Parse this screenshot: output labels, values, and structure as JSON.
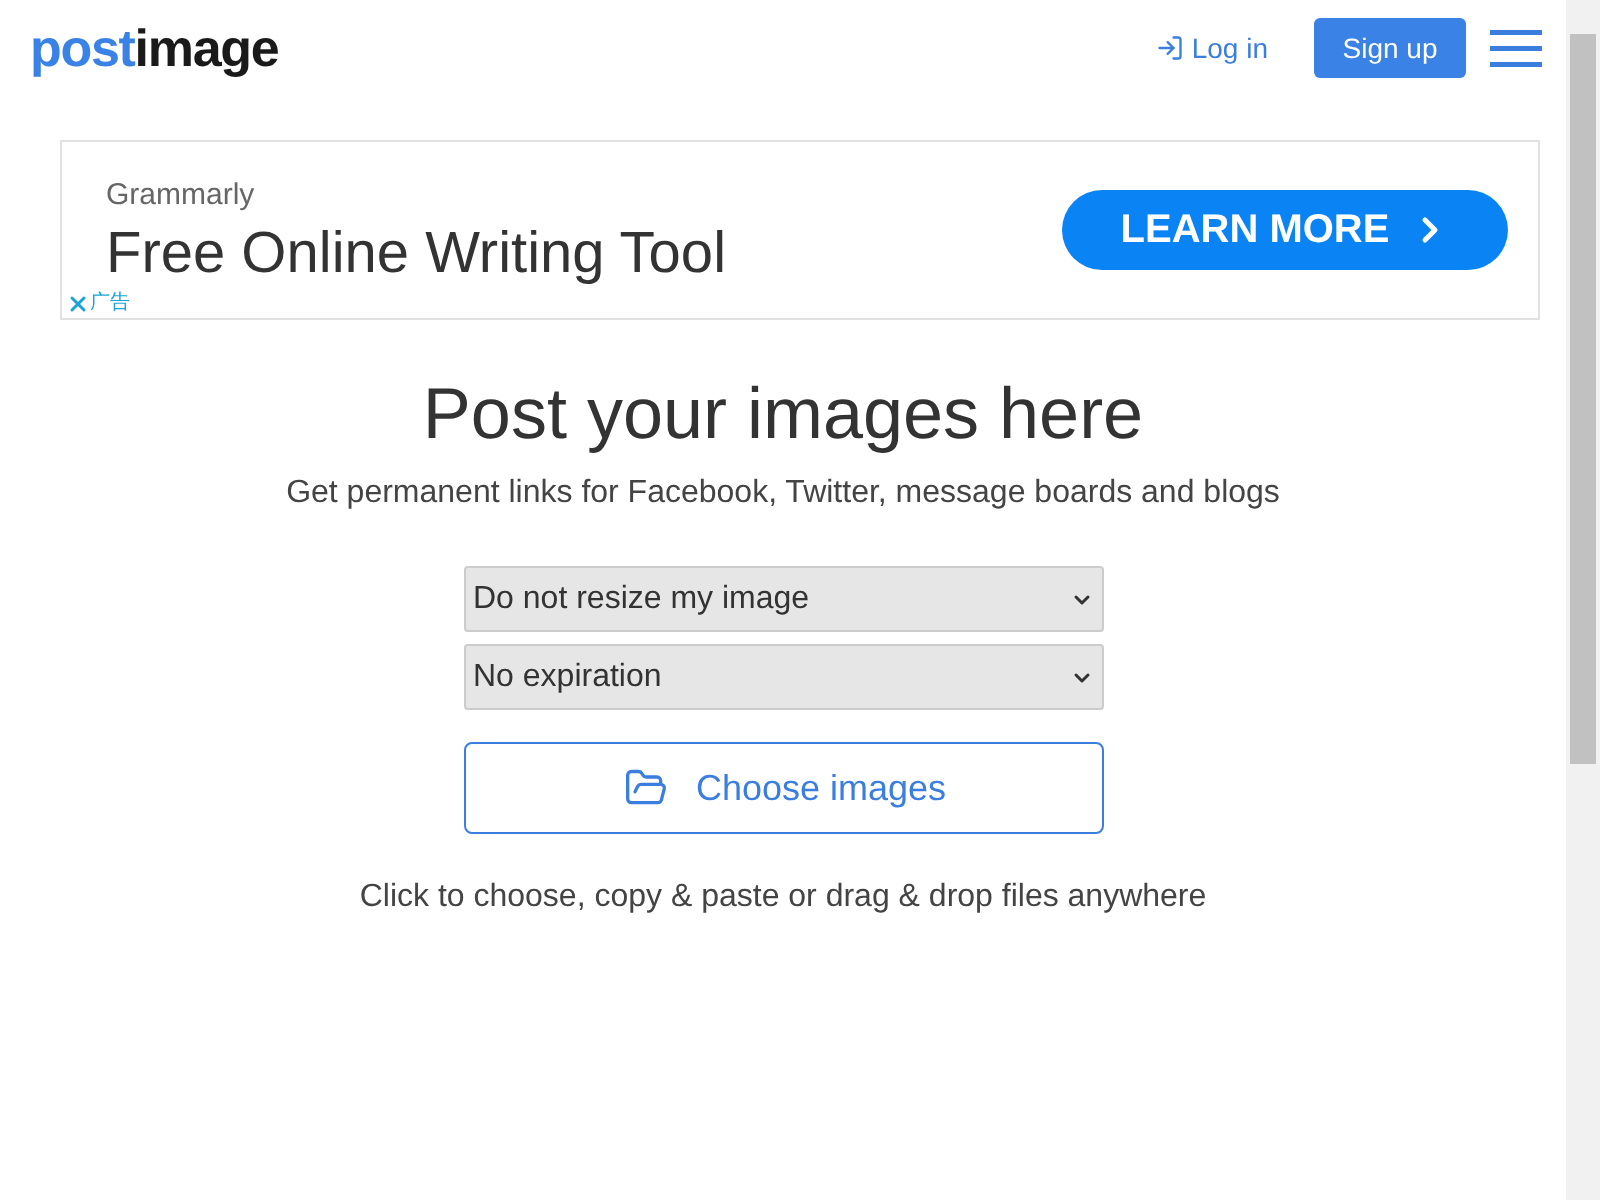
{
  "header": {
    "logo": {
      "first": "post",
      "second": "image"
    },
    "login": "Log in",
    "signup": "Sign up"
  },
  "ad": {
    "brand": "Grammarly",
    "headline": "Free Online Writing Tool",
    "cta": "LEARN MORE",
    "label": "广告"
  },
  "main": {
    "title": "Post your images here",
    "subtitle": "Get permanent links for Facebook, Twitter, message boards and blogs",
    "selects": [
      {
        "value": "Do not resize my image"
      },
      {
        "value": "No expiration"
      }
    ],
    "choose": "Choose images",
    "hint": "Click to choose, copy & paste or drag & drop files anywhere"
  }
}
